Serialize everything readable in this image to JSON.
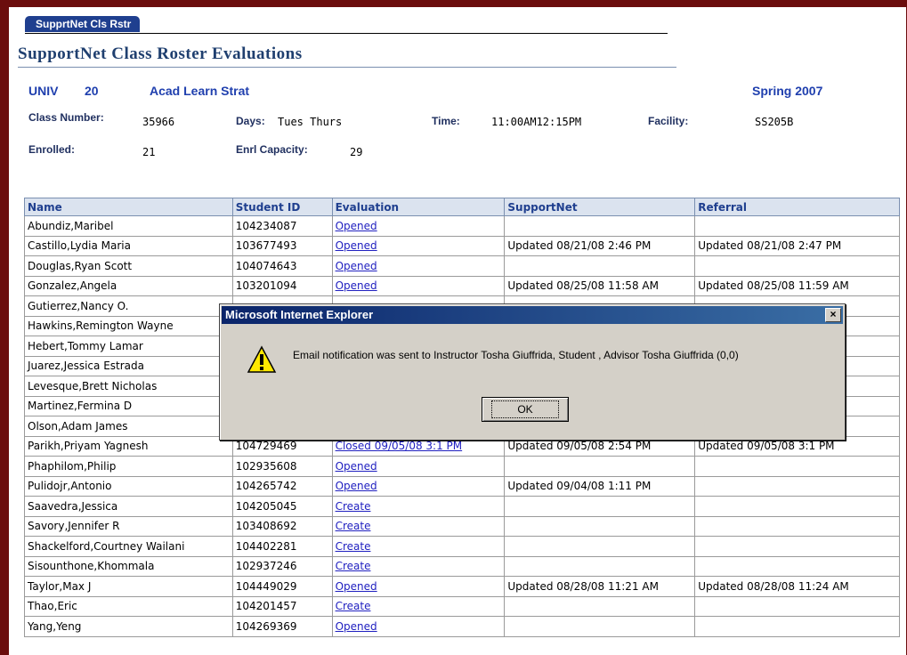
{
  "tab_label": "SupprtNet Cls Rstr",
  "page_title": "SupportNet Class Roster Evaluations",
  "course": {
    "subject": "UNIV",
    "catalog": "20",
    "name": "Acad Learn Strat",
    "term": "Spring 2007"
  },
  "details": {
    "class_number_label": "Class Number:",
    "class_number": "35966",
    "days_label": "Days:",
    "days": "Tues Thurs",
    "time_label": "Time:",
    "time": "11:00AM12:15PM",
    "facility_label": "Facility:",
    "facility": "SS205B",
    "enrolled_label": "Enrolled:",
    "enrolled": "21",
    "capacity_label": "Enrl Capacity:",
    "capacity": "29"
  },
  "table": {
    "headers": [
      "Name",
      "Student ID",
      "Evaluation",
      "SupportNet",
      "Referral"
    ],
    "rows": [
      {
        "name": "Abundiz,Maribel",
        "id": "104234087",
        "evaluation": "Opened",
        "supportnet": "",
        "referral": ""
      },
      {
        "name": "Castillo,Lydia Maria",
        "id": "103677493",
        "evaluation": "Opened",
        "supportnet": "Updated 08/21/08 2:46 PM",
        "referral": "Updated 08/21/08 2:47 PM"
      },
      {
        "name": "Douglas,Ryan Scott",
        "id": "104074643",
        "evaluation": "Opened",
        "supportnet": "",
        "referral": ""
      },
      {
        "name": "Gonzalez,Angela",
        "id": "103201094",
        "evaluation": "Opened",
        "supportnet": "Updated 08/25/08 11:58 AM",
        "referral": "Updated 08/25/08 11:59 AM"
      },
      {
        "name": "Gutierrez,Nancy O.",
        "id": "",
        "evaluation": "",
        "supportnet": "",
        "referral": ""
      },
      {
        "name": "Hawkins,Remington Wayne",
        "id": "",
        "evaluation": "",
        "supportnet": "",
        "referral": ""
      },
      {
        "name": "Hebert,Tommy Lamar",
        "id": "",
        "evaluation": "",
        "supportnet": "",
        "referral": ""
      },
      {
        "name": "Juarez,Jessica Estrada",
        "id": "",
        "evaluation": "",
        "supportnet": "",
        "referral": ""
      },
      {
        "name": "Levesque,Brett Nicholas",
        "id": "",
        "evaluation": "",
        "supportnet": "",
        "referral": ""
      },
      {
        "name": "Martinez,Fermina D",
        "id": "",
        "evaluation": "",
        "supportnet": "",
        "referral": ""
      },
      {
        "name": "Olson,Adam James",
        "id": "",
        "evaluation": "",
        "supportnet": "",
        "referral": ""
      },
      {
        "name": "Parikh,Priyam Yagnesh",
        "id": "104729469",
        "evaluation": "Closed 09/05/08 3:1 PM",
        "supportnet": "Updated 09/05/08 2:54 PM",
        "referral": "Updated 09/05/08 3:1 PM"
      },
      {
        "name": "Phaphilom,Philip",
        "id": "102935608",
        "evaluation": "Opened",
        "supportnet": "",
        "referral": ""
      },
      {
        "name": "Pulidojr,Antonio",
        "id": "104265742",
        "evaluation": "Opened",
        "supportnet": "Updated 09/04/08 1:11 PM",
        "referral": ""
      },
      {
        "name": "Saavedra,Jessica",
        "id": "104205045",
        "evaluation": "Create",
        "supportnet": "",
        "referral": ""
      },
      {
        "name": "Savory,Jennifer R",
        "id": "103408692",
        "evaluation": "Create",
        "supportnet": "",
        "referral": ""
      },
      {
        "name": "Shackelford,Courtney Wailani",
        "id": "104402281",
        "evaluation": "Create",
        "supportnet": "",
        "referral": ""
      },
      {
        "name": "Sisounthone,Khommala",
        "id": "102937246",
        "evaluation": "Create",
        "supportnet": "",
        "referral": ""
      },
      {
        "name": "Taylor,Max J",
        "id": "104449029",
        "evaluation": "Opened",
        "supportnet": "Updated 08/28/08 11:21 AM",
        "referral": "Updated 08/28/08 11:24 AM"
      },
      {
        "name": "Thao,Eric",
        "id": "104201457",
        "evaluation": "Create",
        "supportnet": "",
        "referral": ""
      },
      {
        "name": "Yang,Yeng",
        "id": "104269369",
        "evaluation": "Opened",
        "supportnet": "",
        "referral": ""
      }
    ]
  },
  "dialog": {
    "title": "Microsoft Internet Explorer",
    "close": "×",
    "message": "Email notification was sent to Instructor Tosha Giuffrida, Student , Advisor Tosha Giuffrida (0,0)",
    "ok_label": "OK"
  },
  "colors": {
    "frame": "#6b0d0d",
    "tab": "#1f3f8f",
    "header_bg": "#dbe3ef",
    "link": "#2020c0",
    "dialog_bg": "#d4d0c8",
    "titlebar": "#0a246a"
  },
  "icons": {
    "dialog_icon": "warning-icon"
  }
}
